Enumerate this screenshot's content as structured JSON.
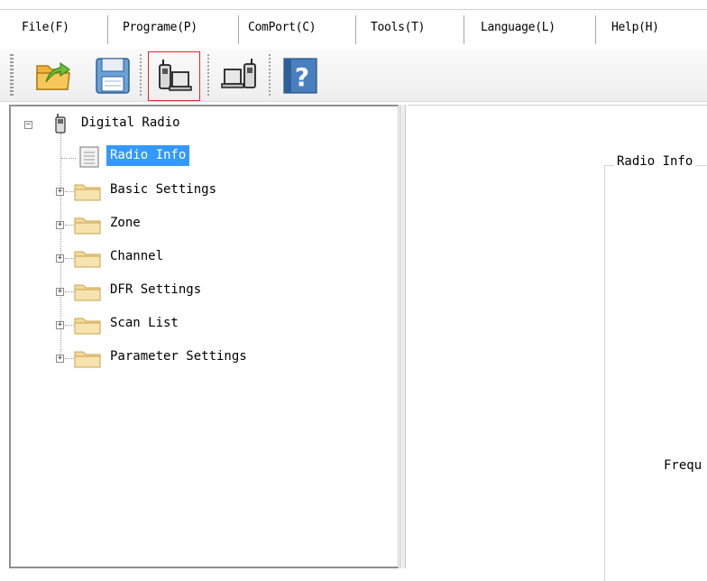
{
  "menu": {
    "items": [
      {
        "label": "File(F)"
      },
      {
        "label": "Programe(P)"
      },
      {
        "label": "ComPort(C)"
      },
      {
        "label": "Tools(T)"
      },
      {
        "label": "Language(L)"
      },
      {
        "label": "Help(H)"
      }
    ]
  },
  "toolbar": {
    "buttons": [
      {
        "icon": "open-folder-icon"
      },
      {
        "icon": "save-disk-icon"
      },
      {
        "icon": "read-from-radio-icon",
        "selected": true
      },
      {
        "icon": "write-to-radio-icon"
      },
      {
        "icon": "help-icon"
      }
    ],
    "highlight_color": "#e0282b"
  },
  "tree": {
    "root": {
      "label": "Digital Radio",
      "expander": "−"
    },
    "items": [
      {
        "label": "Radio Info",
        "selected": true
      },
      {
        "label": "Basic Settings",
        "expander": "+"
      },
      {
        "label": "Zone",
        "expander": "+"
      },
      {
        "label": "Channel",
        "expander": "+"
      },
      {
        "label": "DFR Settings",
        "expander": "+"
      },
      {
        "label": "Scan List",
        "expander": "+"
      },
      {
        "label": "Parameter Settings",
        "expander": "+"
      }
    ],
    "selection_color": "#3399ff"
  },
  "detail": {
    "group_title": "Radio Info",
    "frequency_label": "Frequ"
  }
}
